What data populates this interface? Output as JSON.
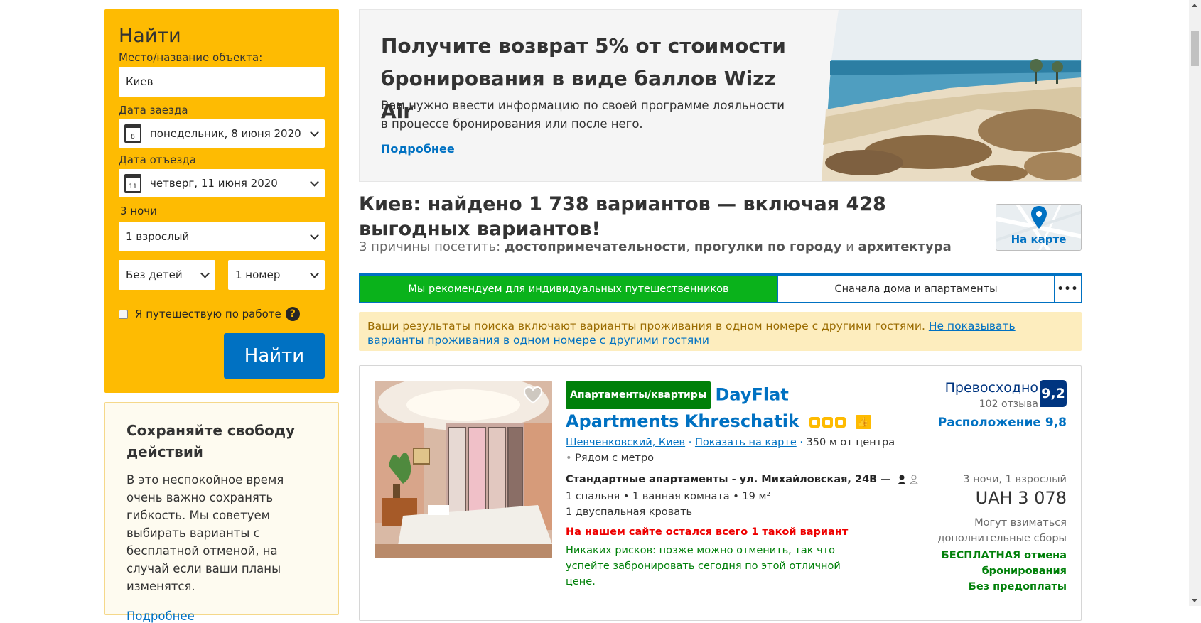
{
  "search": {
    "title": "Найти",
    "destination_label": "Место/название объекта:",
    "destination_value": "Киев",
    "checkin_label": "Дата заезда",
    "checkin_day": "8",
    "checkin_value": "понедельник, 8 июня 2020",
    "checkout_label": "Дата отъезда",
    "checkout_day": "11",
    "checkout_value": "четверг, 11 июня 2020",
    "nights": "3 ночи",
    "adults": "1 взрослый",
    "children": "Без детей",
    "rooms": "1 номер",
    "work_trip_label": "Я путешествую по работе",
    "help_glyph": "?",
    "search_button": "Найти"
  },
  "flex_panel": {
    "title": "Сохраняйте свободу действий",
    "text": "В это неспокойное время очень важно сохранять гибкость. Мы советуем выбирать варианты с бесплатной отменой, на случай если ваши планы изменятся.",
    "link": "Подробнее"
  },
  "banner": {
    "title": "Получите возврат 5% от стоимости бронирования в виде баллов Wizz Air",
    "text": "Вам нужно ввести информацию по своей программе лояльности в процессе бронирования или после него.",
    "link": "Подробнее"
  },
  "results": {
    "heading": "Киев: найдено 1 738 вариантов — включая 428 выгодных вариантов!",
    "reasons_prefix": "3 причины посетить:",
    "reason_1": "достопримечательности",
    "sep_1": ",",
    "reason_2": "прогулки по городу",
    "sep_2": "и",
    "reason_3": "архитектура",
    "map_button": "На карте"
  },
  "sort": {
    "tab_active": "Мы рекомендуем для индивидуальных путешественников",
    "tab_2": "Сначала дома и апартаменты",
    "more": "•••"
  },
  "notice": {
    "text": "Ваши результаты поиска включают варианты проживания в одном номере с другими гостями.",
    "link": "Не показывать варианты проживания в одном номере с другими гостями"
  },
  "property": {
    "type_badge": "Апартаменты/квартиры",
    "name": "DayFlat Apartments Khreschatik",
    "stars": 3,
    "district": "Шевченковский, Киев",
    "show_on_map": "Показать на карте",
    "distance": "350 м от центра",
    "metro": "Рядом с метро",
    "room_title": "Стандартные апартаменты - ул. Михайловская, 24B",
    "room_dash": "—",
    "room_line_1": "1 спальня • 1 ванная комната • 19 м²",
    "room_line_2": "1 двуспальная кровать",
    "urgent": "На нашем сайте остался всего 1 такой вариант",
    "risk_free": "Никаких рисков: позже можно отменить, так что успейте забронировать сегодня по этой отличной цене.",
    "review_word": "Превосходно",
    "review_count": "102 отзыва",
    "score": "9,2",
    "location_score": "Расположение 9,8",
    "stay_info": "3 ночи, 1 взрослый",
    "price": "UAH 3 078",
    "fees": "Могут взиматься дополнительные сборы",
    "free_cancel_1": "БЕСПЛАТНАЯ отмена",
    "free_cancel_2": "бронирования",
    "no_prepay": "Без предоплаты"
  },
  "colors": {
    "brand_blue": "#0071c2",
    "dark_blue": "#003580",
    "search_yellow": "#febb02",
    "green": "#008009",
    "urgent_red": "#e00000"
  }
}
